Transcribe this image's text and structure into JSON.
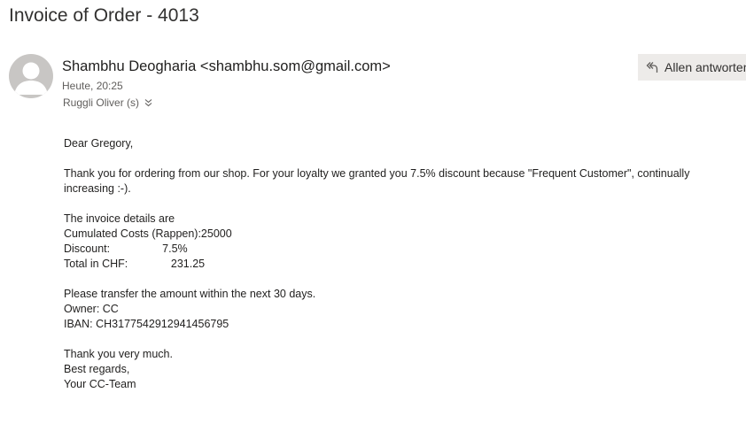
{
  "email": {
    "subject": "Invoice of Order - 4013",
    "sender": "Shambhu Deogharia <shambhu.som@gmail.com>",
    "date": "Heute, 20:25",
    "recipients": "Ruggli Oliver (s)",
    "reply_all_label": "Allen antworten",
    "body": {
      "greeting": "Dear Gregory,",
      "para1": "Thank you for ordering from our shop. For your loyalty we granted you 7.5% discount because \"Frequent Customer\", continually increasing :-).",
      "details_intro": "The invoice details are",
      "costs_line": "Cumulated Costs (Rappen):25000",
      "discount_line": "Discount:                 7.5%",
      "total_line": "Total in CHF:              231.25",
      "transfer": "Please transfer the amount within the next 30 days.",
      "owner": "Owner: CC",
      "iban": "IBAN: CH3177542912941456795",
      "thanks": "Thank you very much.",
      "regards": "Best regards,",
      "signature": "Your CC-Team"
    }
  },
  "icons": {
    "avatar": "person-icon",
    "expand": "double-chevron-down-icon",
    "reply_all": "reply-all-icon"
  }
}
